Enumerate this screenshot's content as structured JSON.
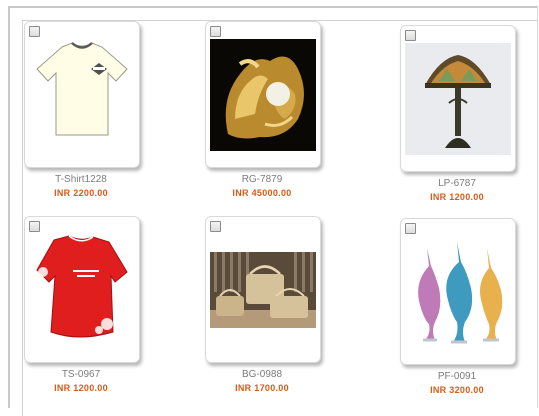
{
  "products": [
    {
      "code": "T-Shirt1228",
      "price": "INR 2200.00",
      "image_icon": "tshirt-image"
    },
    {
      "code": "RG-7879",
      "price": "INR 45000.00",
      "image_icon": "ring-image"
    },
    {
      "code": "LP-6787",
      "price": "INR 1200.00",
      "image_icon": "lamp-image"
    },
    {
      "code": "TS-0967",
      "price": "INR 1200.00",
      "image_icon": "red-top-image"
    },
    {
      "code": "BG-0988",
      "price": "INR 1700.00",
      "image_icon": "handbags-image"
    },
    {
      "code": "PF-0091",
      "price": "INR 3200.00",
      "image_icon": "perfume-bottles-image"
    }
  ],
  "colors": {
    "price": "#d85b17",
    "code": "#7c7c7c",
    "card_border": "#d9d9d9"
  }
}
